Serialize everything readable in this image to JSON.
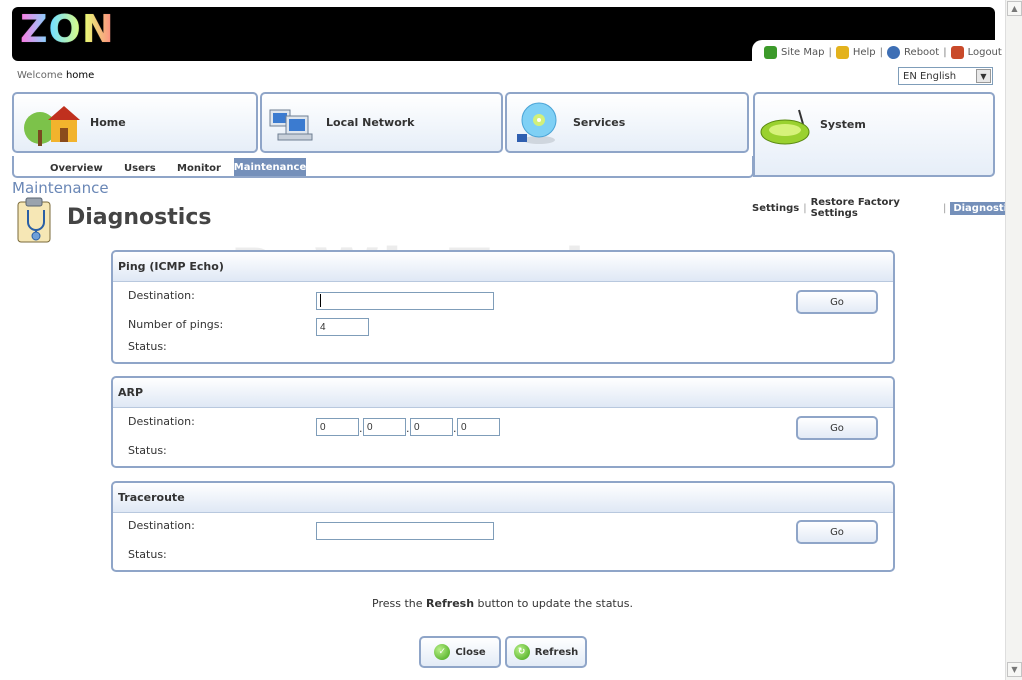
{
  "brand": {
    "logo_text": "ZON"
  },
  "toplinks": [
    {
      "label": "Site Map",
      "icon": "sitemap-icon",
      "color": "#3c9a2a"
    },
    {
      "label": "Help",
      "icon": "help-icon",
      "color": "#e3b21d"
    },
    {
      "label": "Reboot",
      "icon": "power-icon",
      "color": "#3e6fb5"
    },
    {
      "label": "Logout",
      "icon": "logout-icon",
      "color": "#c94a2a"
    }
  ],
  "welcome": {
    "prefix": "Welcome",
    "user": "home"
  },
  "language": {
    "selected": "EN English"
  },
  "main_tabs": [
    {
      "label": "Home",
      "icon": "house-tree-icon"
    },
    {
      "label": "Local Network",
      "icon": "computers-icon"
    },
    {
      "label": "Services",
      "icon": "disc-icon"
    },
    {
      "label": "System",
      "icon": "router-icon",
      "active": true
    }
  ],
  "subnav": {
    "items": [
      "Overview",
      "Users",
      "Monitor"
    ],
    "active": "Maintenance"
  },
  "section_title": "Maintenance",
  "page_title": "Diagnostics",
  "crumbs": {
    "links": [
      "Settings",
      "Restore Factory Settings"
    ],
    "active": "Diagnostics"
  },
  "watermark": "PcWinTech.com",
  "ping": {
    "title": "Ping (ICMP Echo)",
    "destination_label": "Destination:",
    "destination_value": "",
    "pings_label": "Number of pings:",
    "pings_value": "4",
    "status_label": "Status:",
    "go": "Go"
  },
  "arp": {
    "title": "ARP",
    "destination_label": "Destination:",
    "ip": [
      "0",
      "0",
      "0",
      "0"
    ],
    "status_label": "Status:",
    "go": "Go"
  },
  "traceroute": {
    "title": "Traceroute",
    "destination_label": "Destination:",
    "destination_value": "",
    "status_label": "Status:",
    "go": "Go"
  },
  "info": {
    "before": "Press the",
    "bold": "Refresh",
    "after": "button to update the status."
  },
  "buttons": {
    "close": "Close",
    "refresh": "Refresh"
  },
  "colors": {
    "accent": "#7590ba",
    "border": "#8fa5c8",
    "header_bg": "#000000"
  }
}
